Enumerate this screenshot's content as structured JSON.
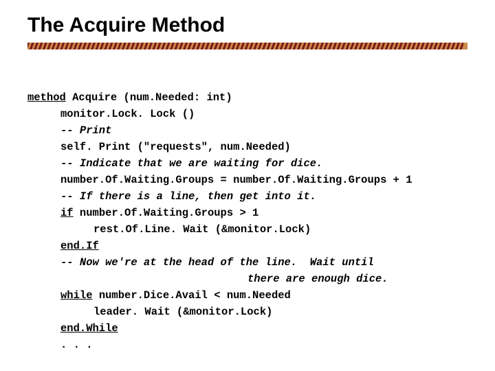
{
  "slide": {
    "title": "The Acquire Method"
  },
  "code": {
    "l1a": "method",
    "l1b": " Acquire (num.Needed: int)",
    "l2": "monitor.Lock. Lock ()",
    "l3": "-- Print",
    "l4": "self. Print (\"requests\", num.Needed)",
    "l5": "-- Indicate that we are waiting for dice.",
    "l6": "number.Of.Waiting.Groups = number.Of.Waiting.Groups + 1",
    "l7": "-- If there is a line, then get into it.",
    "l8a": "if",
    "l8b": " number.Of.Waiting.Groups > 1",
    "l9": "rest.Of.Line. Wait (&monitor.Lock)",
    "l10": "end.If",
    "l11": "-- Now we're at the head of the line.  Wait until",
    "l11b": "there are enough dice.",
    "l12a": "while",
    "l12b": " number.Dice.Avail < num.Needed",
    "l13": "leader. Wait (&monitor.Lock)",
    "l14": "end.While",
    "l15": ". . ."
  }
}
